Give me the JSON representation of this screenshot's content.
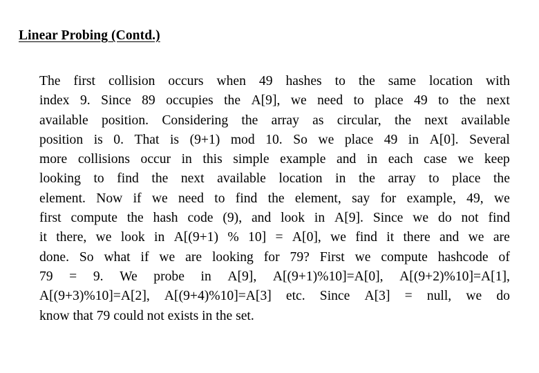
{
  "slide": {
    "title": "Linear Probing (Contd.)",
    "background_color": "#ffffff",
    "text_color": "#000000",
    "paragraph": "The first collision occurs when 49 hashes to the same location with index 9. Since 89 occupies the A[9], we need to place 49 to the next available position. Considering the array as circular, the next available position is 0. That is (9+1) mod 10. So we place 49 in A[0]. Several more collisions occur in this simple example and in each case we keep looking to find the next available location in the array to place the element. Now if we need to find the element, say for example, 49, we first compute the hash code (9), and look in A[9]. Since we do not find it there, we look in A[(9+1) % 10] = A[0], we find it there and we are done. So what if we are looking for 79? First we compute hashcode of 79 = 9. We probe in A[9], A[(9+1)%10]=A[0], A[(9+2)%10]=A[1], A[(9+3)%10]=A[2], A[(9+4)%10]=A[3] etc. Since A[3] = null, we do know that 79 could not exists in the set.",
    "lines": [
      "The first collision occurs when 49 hashes to the same location with",
      "index 9. Since 89 occupies the A[9], we need to place 49 to the next",
      "available position. Considering the array as circular, the next available",
      "position is 0. That is (9+1) mod 10. So we place 49 in A[0]. Several",
      "more collisions occur in this simple example and in each case we keep",
      "looking to find the next available location in the array to place the",
      "element. Now if we need to find the element, say for example, 49, we",
      "first compute the hash code (9), and look in A[9]. Since we do not find",
      "it there, we look in A[(9+1) % 10] = A[0], we find it there and we are",
      "done. So what if we are looking for 79? First we compute hashcode of",
      "79 = 9. We probe in A[9], A[(9+1)%10]=A[0], A[(9+2)%10]=A[1],",
      "A[(9+3)%10]=A[2], A[(9+4)%10]=A[3] etc. Since A[3] = null, we do",
      "know that 79 could not exists in the set."
    ]
  }
}
